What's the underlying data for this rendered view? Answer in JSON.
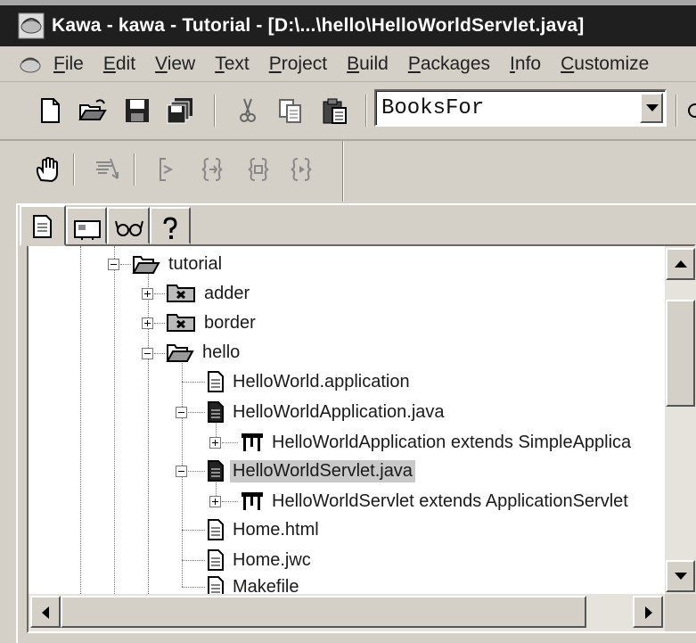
{
  "window": {
    "title": "Kawa - kawa - Tutorial - [D:\\...\\hello\\HelloWorldServlet.java]"
  },
  "menubar": {
    "items": [
      "File",
      "Edit",
      "View",
      "Text",
      "Project",
      "Build",
      "Packages",
      "Info",
      "Customize"
    ]
  },
  "toolbar": {
    "combo_value": "BooksFor"
  },
  "tree": {
    "nodes": [
      {
        "label": "tutorial",
        "icon": "open-folder-icon",
        "expander": "minus"
      },
      {
        "label": "adder",
        "icon": "package-folder-icon",
        "expander": "plus"
      },
      {
        "label": "border",
        "icon": "package-folder-icon",
        "expander": "plus"
      },
      {
        "label": "hello",
        "icon": "open-folder-icon",
        "expander": "minus"
      },
      {
        "label": "HelloWorld.application",
        "icon": "document-icon",
        "expander": "none"
      },
      {
        "label": "HelloWorldApplication.java",
        "icon": "java-file-icon",
        "expander": "minus"
      },
      {
        "label": "HelloWorldApplication extends SimpleApplica",
        "icon": "class-icon",
        "expander": "plus"
      },
      {
        "label": "HelloWorldServlet.java",
        "icon": "java-file-icon",
        "expander": "minus",
        "selected": true
      },
      {
        "label": "HelloWorldServlet extends ApplicationServlet",
        "icon": "class-icon",
        "expander": "plus"
      },
      {
        "label": "Home.html",
        "icon": "document-icon",
        "expander": "none"
      },
      {
        "label": "Home.jwc",
        "icon": "document-icon",
        "expander": "none"
      },
      {
        "label": "Makefile",
        "icon": "document-icon",
        "expander": "none"
      }
    ]
  },
  "colors": {
    "title_bar": "#1f1f1f",
    "chrome": "#d4d0c8",
    "selection": "#c9c9c9"
  }
}
